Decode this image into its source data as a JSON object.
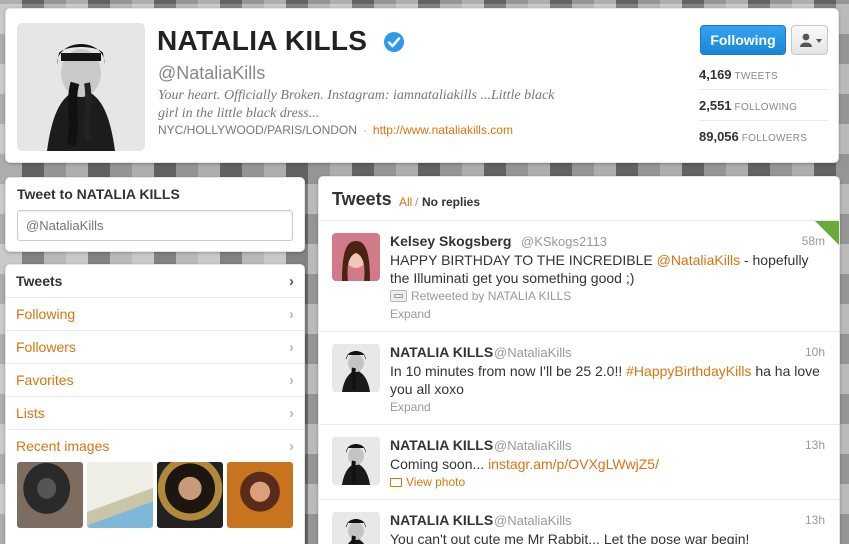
{
  "profile": {
    "name": "NATALIA KILLS",
    "handle": "@NataliaKills",
    "bio": "Your heart. Officially Broken. Instagram: iamnataliakills ...Little black girl in the little black dress...",
    "location": "NYC/HOLLYWOOD/PARIS/LONDON",
    "location_sep": "·",
    "url": "http://www.nataliakills.com",
    "follow_label": "Following",
    "stats": [
      {
        "count": "4,169",
        "label": "TWEETS"
      },
      {
        "count": "2,551",
        "label": "FOLLOWING"
      },
      {
        "count": "89,056",
        "label": "FOLLOWERS"
      }
    ]
  },
  "tweet_to": {
    "title": "Tweet to NATALIA KILLS",
    "placeholder": "@NataliaKills"
  },
  "nav": {
    "items": [
      {
        "label": "Tweets",
        "active": true
      },
      {
        "label": "Following"
      },
      {
        "label": "Followers"
      },
      {
        "label": "Favorites"
      },
      {
        "label": "Lists"
      },
      {
        "label": "Recent images"
      }
    ],
    "chevron": "›"
  },
  "stream": {
    "title": "Tweets",
    "filter_all": "All",
    "filter_sep": "/",
    "filter_noreplies": "No replies",
    "tweets": [
      {
        "name": "Kelsey Skogsberg",
        "handle": "@KSkogs2113",
        "time": "58m",
        "text_parts": [
          "HAPPY BIRTHDAY TO THE INCREDIBLE ",
          "@NataliaKills",
          " - hopefully the Illuminati get you something good ;)"
        ],
        "retweeted_by": "Retweeted by NATALIA KILLS",
        "action": "Expand"
      },
      {
        "name": "NATALIA KILLS",
        "handle": "@NataliaKills",
        "time": "10h",
        "text_parts": [
          "In 10 minutes from now I'll be 25 2.0!! ",
          "#HappyBirthdayKills",
          " ha ha love you all xoxo"
        ],
        "action": "Expand"
      },
      {
        "name": "NATALIA KILLS",
        "handle": "@NataliaKills",
        "time": "13h",
        "text_parts": [
          "Coming soon... ",
          "instagr.am/p/OVXgLWwjZ5/"
        ],
        "action": "View photo"
      },
      {
        "name": "NATALIA KILLS",
        "handle": "@NataliaKills",
        "time": "13h",
        "text_parts": [
          "You can't out cute me Mr Rabbit... Let the pose war begin!"
        ]
      }
    ]
  },
  "colors": {
    "link": "#d9740f",
    "follow_button": "#1a86d6",
    "verified": "#2b9ae8",
    "retweet_corner": "#6aaa3a"
  }
}
